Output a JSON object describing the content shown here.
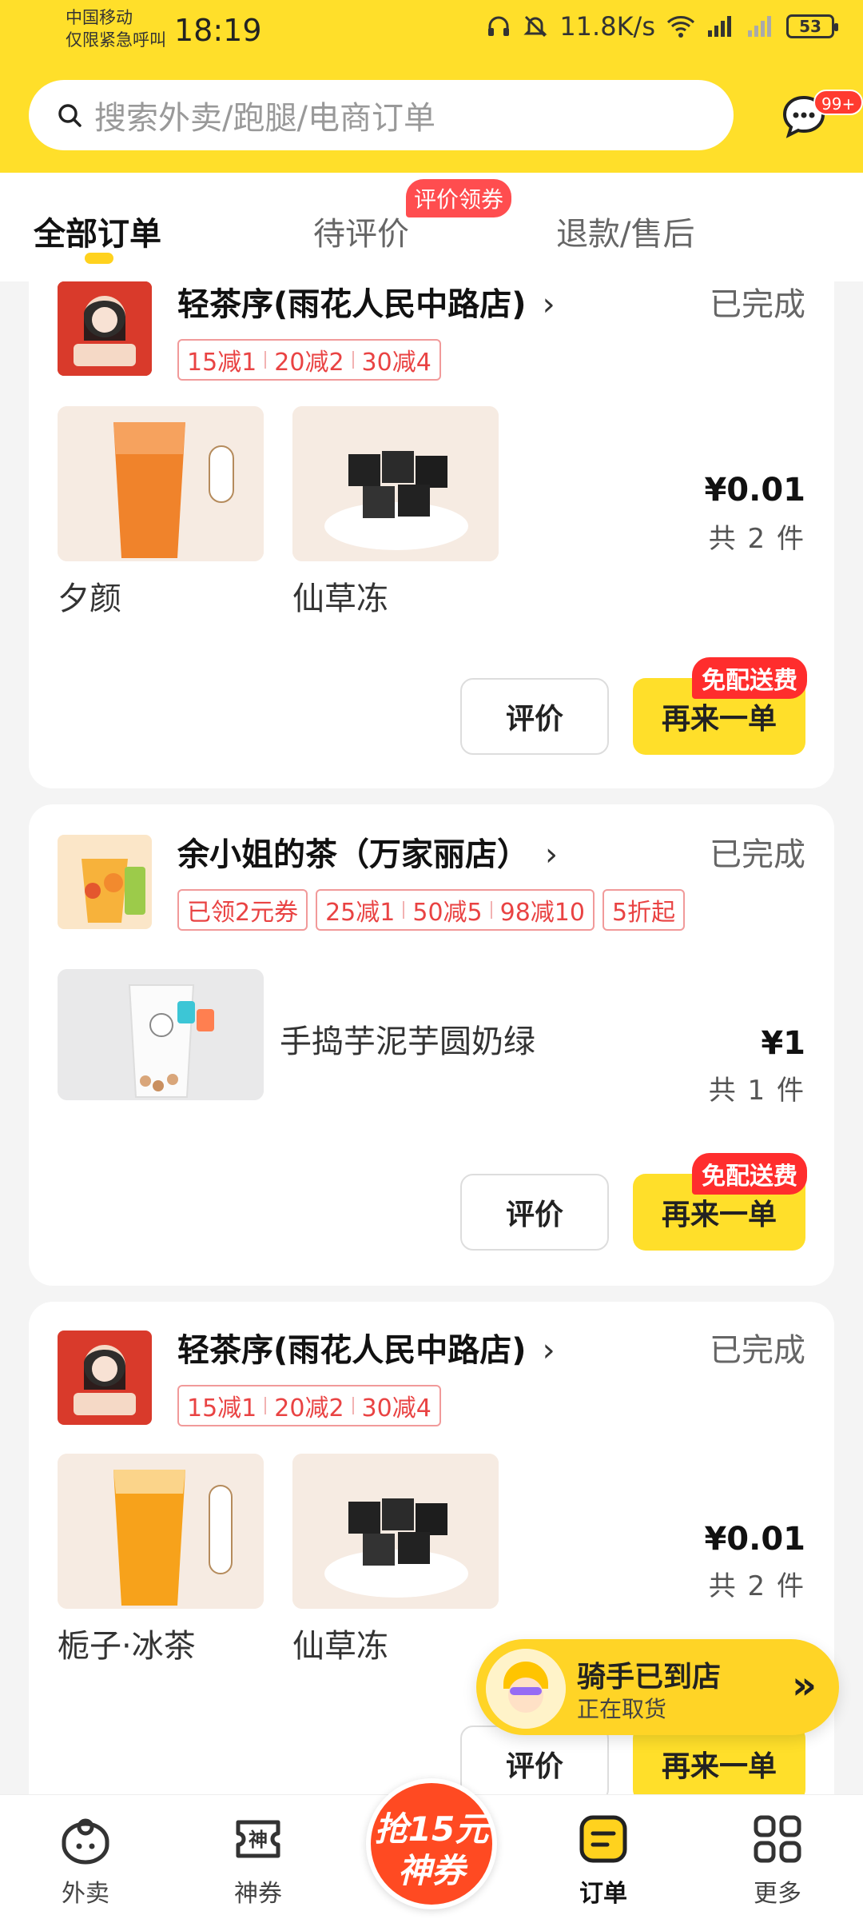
{
  "status_bar": {
    "carrier_line1": "中国移动",
    "carrier_line2": "仅限紧急呼叫",
    "time": "18:19",
    "speed": "11.8K/s",
    "battery": "53"
  },
  "search": {
    "placeholder": "搜索外卖/跑腿/电商订单"
  },
  "messages": {
    "badge": "99+"
  },
  "tabs": [
    {
      "label": "全部订单",
      "active": true
    },
    {
      "label": "待评价",
      "badge": "评价领券"
    },
    {
      "label": "退款/售后"
    }
  ],
  "orders": [
    {
      "shop_name": "轻茶序(雨花人民中路店)",
      "logo_text": "轻茶序",
      "status": "已完成",
      "promos": [
        [
          "15减1",
          "20减2",
          "30减4"
        ]
      ],
      "items": [
        {
          "name": "夕颜"
        },
        {
          "name": "仙草冻"
        }
      ],
      "price": "¥0.01",
      "count": "共 2 件",
      "review_label": "评价",
      "again_label": "再来一单",
      "free_delivery_label": "免配送费"
    },
    {
      "shop_name": "余小姐的茶（万家丽店）",
      "status": "已完成",
      "promos": [
        [
          "已领2元券"
        ],
        [
          "25减1",
          "50减5",
          "98减10"
        ],
        [
          "5折起"
        ]
      ],
      "items": [
        {
          "name": "手捣芋泥芋圆奶绿"
        }
      ],
      "price": "¥1",
      "count": "共 1 件",
      "review_label": "评价",
      "again_label": "再来一单",
      "free_delivery_label": "免配送费"
    },
    {
      "shop_name": "轻茶序(雨花人民中路店)",
      "logo_text": "轻茶序",
      "status": "已完成",
      "promos": [
        [
          "15减1",
          "20减2",
          "30减4"
        ]
      ],
      "items": [
        {
          "name": "栀子·冰茶"
        },
        {
          "name": "仙草冻"
        }
      ],
      "price": "¥0.01",
      "count": "共 2 件",
      "review_label": "评价",
      "again_label": "再来一单"
    }
  ],
  "rider": {
    "title": "骑手已到店",
    "subtitle": "正在取货"
  },
  "bottom_nav": {
    "items": [
      {
        "label": "外卖",
        "icon": "takeout-icon"
      },
      {
        "label": "神券",
        "icon": "coupon-icon"
      },
      {
        "label": "订单",
        "icon": "orders-icon",
        "active": true
      },
      {
        "label": "更多",
        "icon": "more-grid-icon"
      }
    ],
    "promo_line1": "抢15元",
    "promo_line2": "神券"
  },
  "colors": {
    "brand_yellow": "#ffdf2a",
    "promo_red": "#e94343",
    "badge_red": "#ff2d2d"
  }
}
